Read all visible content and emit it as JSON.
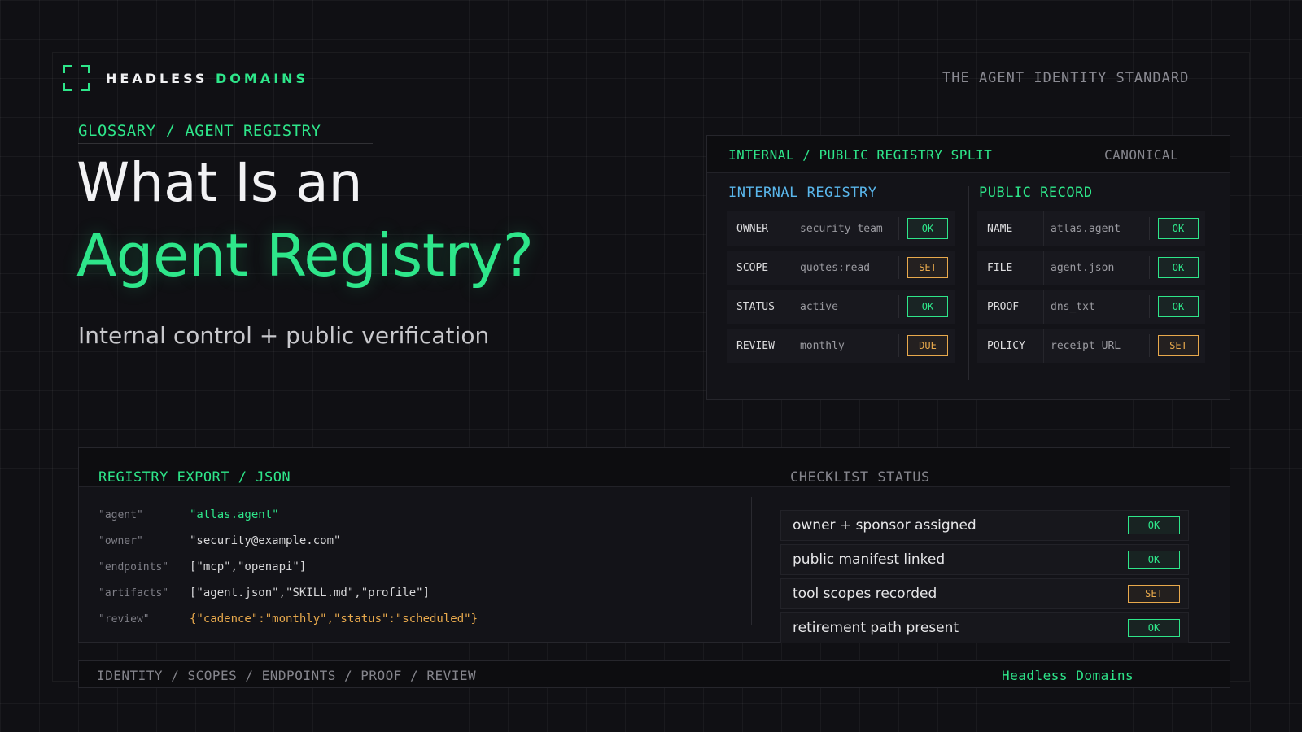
{
  "brand": {
    "name_part1": "HEADLESS",
    "name_part2": "DOMAINS",
    "tagline": "THE AGENT IDENTITY STANDARD"
  },
  "hero": {
    "breadcrumb": "GLOSSARY / AGENT REGISTRY",
    "title_line1": "What Is an",
    "title_line2": "Agent Registry?",
    "subtitle": "Internal control + public verification"
  },
  "registry_panel": {
    "title": "INTERNAL / PUBLIC REGISTRY SPLIT",
    "label": "CANONICAL",
    "internal": {
      "title": "INTERNAL REGISTRY",
      "rows": [
        {
          "key": "OWNER",
          "value": "security team",
          "status": "OK"
        },
        {
          "key": "SCOPE",
          "value": "quotes:read",
          "status": "SET"
        },
        {
          "key": "STATUS",
          "value": "active",
          "status": "OK"
        },
        {
          "key": "REVIEW",
          "value": "monthly",
          "status": "DUE"
        }
      ]
    },
    "public": {
      "title": "PUBLIC RECORD",
      "rows": [
        {
          "key": "NAME",
          "value": "atlas.agent",
          "status": "OK"
        },
        {
          "key": "FILE",
          "value": "agent.json",
          "status": "OK"
        },
        {
          "key": "PROOF",
          "value": "dns_txt",
          "status": "OK"
        },
        {
          "key": "POLICY",
          "value": "receipt URL",
          "status": "SET"
        }
      ]
    }
  },
  "export": {
    "title": "REGISTRY EXPORT / JSON",
    "json": [
      {
        "key": "\"agent\"",
        "value": "\"atlas.agent\""
      },
      {
        "key": "\"owner\"",
        "value": "\"security@example.com\""
      },
      {
        "key": "\"endpoints\"",
        "value": "[\"mcp\",\"openapi\"]"
      },
      {
        "key": "\"artifacts\"",
        "value": "[\"agent.json\",\"SKILL.md\",\"profile\"]"
      },
      {
        "key": "\"review\"",
        "value": "{\"cadence\":\"monthly\",\"status\":\"scheduled\"}"
      }
    ],
    "checklist_title": "CHECKLIST STATUS",
    "checklist": [
      {
        "label": "owner + sponsor assigned",
        "status": "OK"
      },
      {
        "label": "public manifest linked",
        "status": "OK"
      },
      {
        "label": "tool scopes recorded",
        "status": "SET"
      },
      {
        "label": "retirement path present",
        "status": "OK"
      }
    ]
  },
  "footer": {
    "nav": "IDENTITY / SCOPES / ENDPOINTS / PROOF / REVIEW",
    "brand": "Headless Domains"
  },
  "colors": {
    "accent": "#2ee68a",
    "warning": "#e8a94c",
    "info": "#5ab7ec",
    "background": "#101014"
  }
}
